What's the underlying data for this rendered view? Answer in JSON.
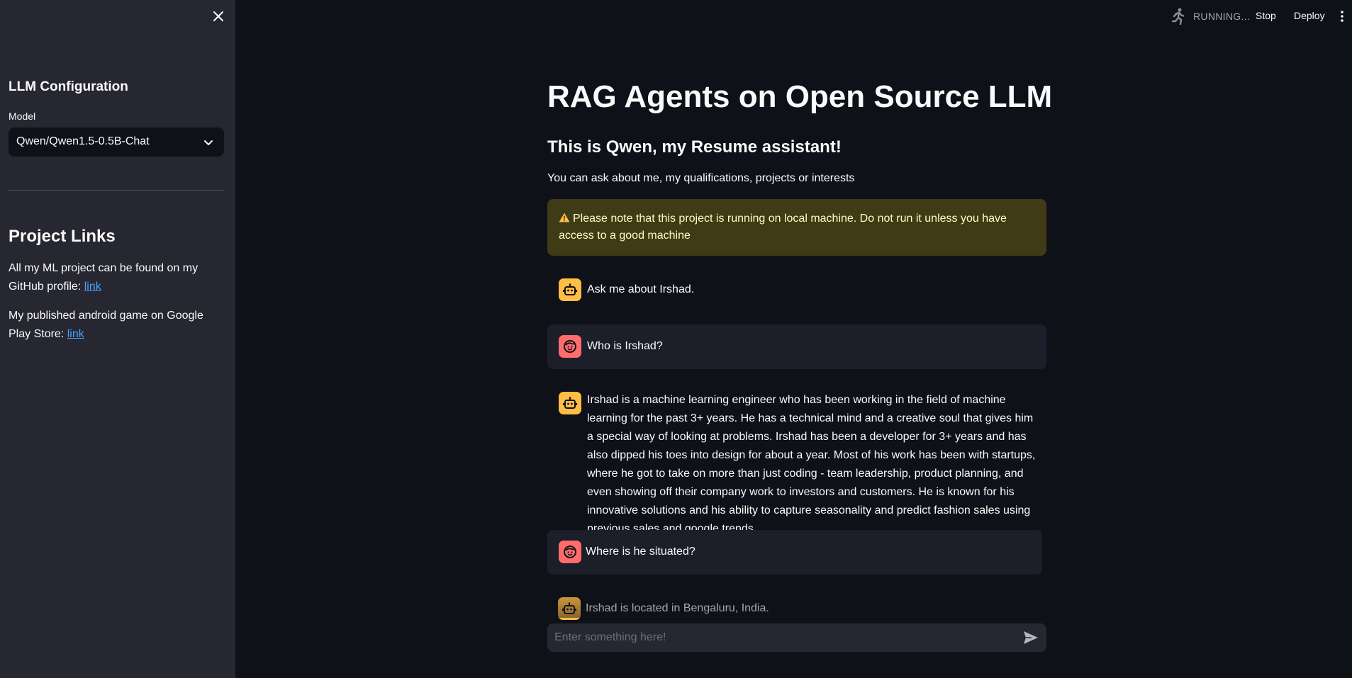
{
  "sidebar": {
    "config_heading": "LLM Configuration",
    "model_label": "Model",
    "model_selected": "Qwen/Qwen1.5-0.5B-Chat",
    "links_heading": "Project Links",
    "github_text": "All my ML project can be found on my GitHub profile: ",
    "github_link": "link",
    "play_text": "My published android game on Google Play Store: ",
    "play_link": "link"
  },
  "header": {
    "status": "RUNNING...",
    "stop_label": "Stop",
    "deploy_label": "Deploy"
  },
  "main": {
    "title": "RAG Agents on Open Source LLM",
    "subtitle": "This is Qwen, my Resume assistant!",
    "intro": "You can ask about me, my qualifications, projects or interests",
    "warning": "Please note that this project is running on local machine. Do not run it unless you have access to a good machine"
  },
  "messages": [
    {
      "role": "assistant",
      "text": "Ask me about Irshad."
    },
    {
      "role": "user",
      "text": "Who is Irshad?"
    },
    {
      "role": "assistant",
      "text": "Irshad is a machine learning engineer who has been working in the field of machine learning for the past 3+ years. He has a technical mind and a creative soul that gives him a special way of looking at problems. Irshad has been a developer for 3+ years and has also dipped his toes into design for about a year. Most of his work has been with startups, where he got to take on more than just coding - team leadership, product planning, and even showing off their company work to investors and customers. He is known for his innovative solutions and his ability to capture seasonality and predict fashion sales using previous sales and google trends."
    },
    {
      "role": "user",
      "text": "Where is he situated?"
    },
    {
      "role": "assistant",
      "text": "Irshad is located in Bengaluru, India."
    }
  ],
  "chat_input": {
    "placeholder": "Enter something here!"
  },
  "colors": {
    "background": "#0e1117",
    "sidebar": "#262730",
    "bot_avatar": "#ffbd45",
    "user_avatar": "#ff6c6c",
    "warning_bg": "#3e3b16",
    "link": "#4aa3ff"
  },
  "icons": [
    "close-icon",
    "chevron-down-icon",
    "running-man-icon",
    "kebab-menu-icon",
    "warning-icon",
    "robot-icon",
    "face-icon",
    "send-icon"
  ]
}
